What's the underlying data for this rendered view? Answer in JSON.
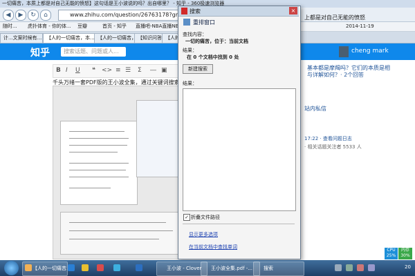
{
  "browser": {
    "window_title": "一切痛苦，本质上都是对自己无能的愤怒】这句话是王小波说的吗？出自哪里？ - 知乎 - 360极速浏览器",
    "url": "www.zhihu.com/question/26763178?group_id",
    "bookmarks": [
      "随时...",
      "虎扑体育 - 你的体...",
      "豆瓣",
      "首页 - 知乎",
      "直播吧-NBA直播NB..."
    ],
    "bookmark_date": "2014-11-19",
    "tabs": [
      "计...文案时候有...",
      "【人的一切痛苦，本...",
      "【人的一切痛苦，本质上都是对...",
      "【知识问答】",
      "【人的一切痛苦..."
    ]
  },
  "zhihu": {
    "logo": "知乎",
    "search_placeholder": "搜索话题、问题或人...",
    "user_name": "cheng mark",
    "editor_text": "千头万绪一套PDF版的王小波全集，通过关键词搜索，没有找到",
    "right_title": "上都是对自己无能的愤怒",
    "right_q1": "基本都是摩羯吗？它们的本质是相",
    "right_q2": "与详解如何？· 2个回答",
    "private_msg": "站内私信",
    "log_line": "17:22 · 查看问题日志",
    "followers_line": "· 相关话题关注者 5533 人"
  },
  "dialog": {
    "title": "搜索",
    "reset_label": "重排窗口",
    "find_label": "查找内容：",
    "find_value": "一切的痛苦，位于：当前文档",
    "result_label": "结果：",
    "result_value": "在 0 个文档中找到 0 处",
    "new_search_label": "新建搜索",
    "results_label": "结果：",
    "checkbox_label": "折叠文件路径",
    "checkbox_checked": true,
    "more_options": "显示更多选项",
    "find_in_doc": "在当前文档中查找单词",
    "close_glyph": "×"
  },
  "taskbar": {
    "tasks": [
      "【人的一切痛苦...",
      "王小波 - Clover",
      "王小波全集.pdf -...",
      "搜索"
    ],
    "cpu_label": "CPU",
    "cpu_value": "25%",
    "mem_label": "内存",
    "mem_value": "30%",
    "clock": "20"
  }
}
